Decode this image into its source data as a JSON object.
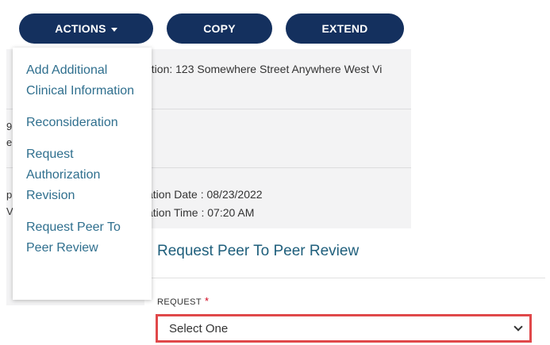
{
  "toolbar": {
    "actions_label": "ACTIONS",
    "copy_label": "COPY",
    "extend_label": "EXTEND"
  },
  "actions_menu": {
    "items": [
      {
        "label": "Add Additional Clinical Information"
      },
      {
        "label": "Reconsideration"
      },
      {
        "label": "Request Authorization Revision"
      },
      {
        "label": "Request Peer To Peer Review"
      }
    ]
  },
  "background_details": {
    "location_text": "ation: 123 Somewhere Street Anywhere West Vi",
    "partial_left_1": "9",
    "partial_left_2": "e",
    "partial_left_3": "p",
    "partial_left_4": "V",
    "date_text": "ation Date : 08/23/2022",
    "time_text": "ation Time : 07:20 AM"
  },
  "peer_review_form": {
    "title": "Request Peer To Peer Review",
    "request_label": "REQUEST",
    "required_marker": "*",
    "request_value": "Select One"
  },
  "colors": {
    "primary_button": "#14305e",
    "menu_link": "#2f6f8e",
    "form_title": "#1f5f7c",
    "highlight_border": "#e0484a",
    "required": "#d0021b"
  }
}
